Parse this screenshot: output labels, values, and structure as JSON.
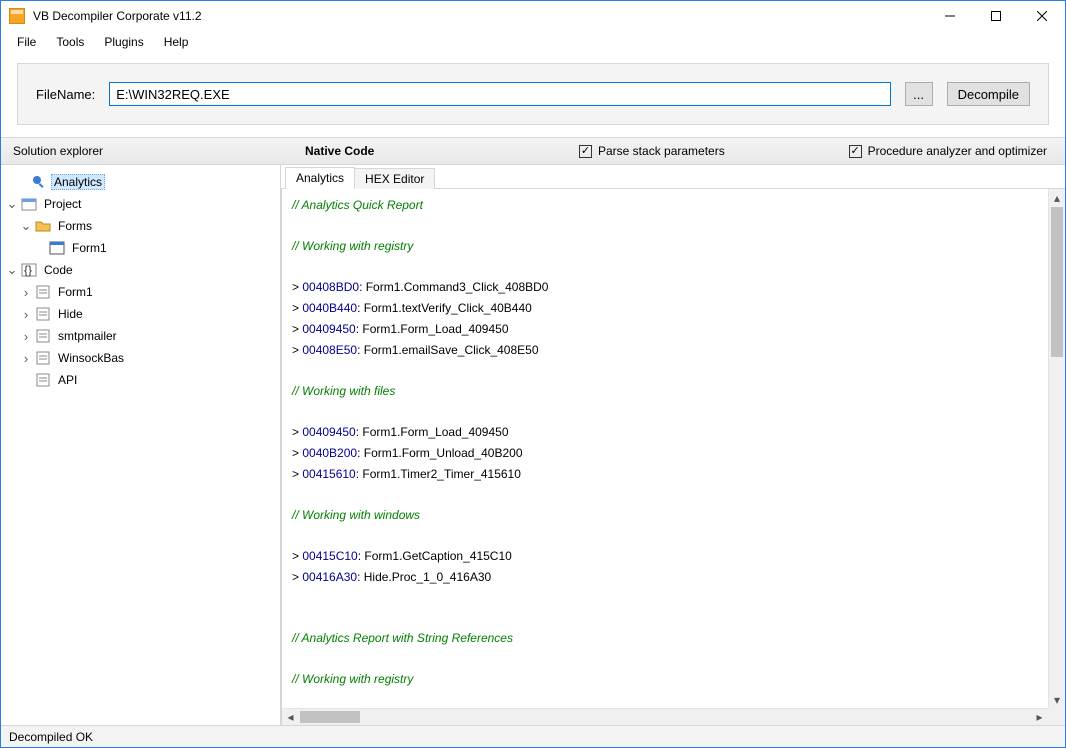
{
  "window": {
    "title": "VB Decompiler Corporate v11.2"
  },
  "menu": {
    "items": [
      "File",
      "Tools",
      "Plugins",
      "Help"
    ]
  },
  "fileBar": {
    "label": "FileName:",
    "value": "E:\\WIN32REQ.EXE",
    "browse": "...",
    "decompile": "Decompile"
  },
  "header": {
    "solExplorer": "Solution explorer",
    "codeType": "Native Code",
    "check1": "Parse stack parameters",
    "check2": "Procedure analyzer and optimizer"
  },
  "tree": {
    "analytics": "Analytics",
    "project": "Project",
    "forms": "Forms",
    "form1": "Form1",
    "code": "Code",
    "codeForm1": "Form1",
    "hide": "Hide",
    "smtp": "smtpmailer",
    "winsock": "WinsockBas",
    "api": "API"
  },
  "tabs": {
    "t1": "Analytics",
    "t2": "HEX Editor"
  },
  "code": {
    "c1": "// Analytics Quick Report",
    "c2": "// Working with registry",
    "r1a": "00408BD0",
    "r1b": ": Form1.Command3_Click_408BD0",
    "r2a": "0040B440",
    "r2b": ": Form1.textVerify_Click_40B440",
    "r3a": "00409450",
    "r3b": ": Form1.Form_Load_409450",
    "r4a": "00408E50",
    "r4b": ": Form1.emailSave_Click_408E50",
    "c3": "// Working with files",
    "r5a": "00409450",
    "r5b": ": Form1.Form_Load_409450",
    "r6a": "0040B200",
    "r6b": ": Form1.Form_Unload_40B200",
    "r7a": "00415610",
    "r7b": ": Form1.Timer2_Timer_415610",
    "c4": "// Working with windows",
    "r8a": "00415C10",
    "r8b": ": Form1.GetCaption_415C10",
    "r9a": "00416A30",
    "r9b": ": Hide.Proc_1_0_416A30",
    "c5": "// Analytics Report with String References",
    "c6": "// Working with registry"
  },
  "status": {
    "text": "Decompiled OK"
  }
}
